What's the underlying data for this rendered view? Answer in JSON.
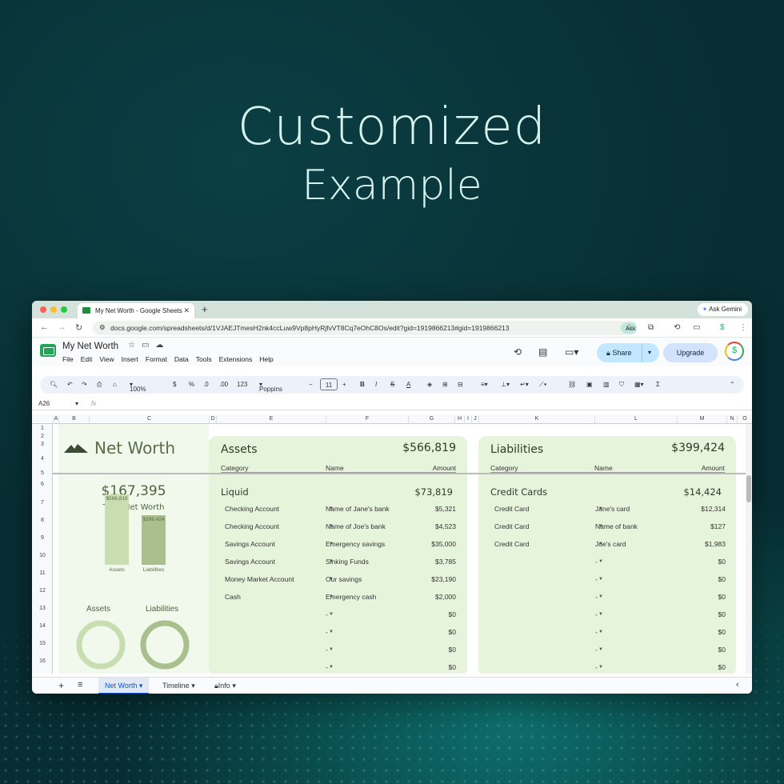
{
  "heading": {
    "line1": "Customized",
    "line2": "Example"
  },
  "browser": {
    "tab_title": "My Net Worth - Google Sheets",
    "new_tab": "+",
    "ask_gemini": "Ask Gemini",
    "url": "docs.google.com/spreadsheets/d/1VJAEJTmesH2nk4ccLuw9Vp8pHyRjfvVT8Cq7eOhC8Os/edit?gid=1919866213#gid=1919866213",
    "ask_google": "Ask Google"
  },
  "app": {
    "doc_title": "My Net Worth",
    "menu": [
      "File",
      "Edit",
      "View",
      "Insert",
      "Format",
      "Data",
      "Tools",
      "Extensions",
      "Help"
    ],
    "share": "Share",
    "upgrade": "Upgrade",
    "avatar": "$"
  },
  "toolbar": {
    "zoom": "100%",
    "currency": "$",
    "percent": "%",
    "dec_dec": ".0",
    "dec_inc": ".00",
    "num_format": "123",
    "font": "Poppins",
    "font_size": "11"
  },
  "formula_bar": {
    "name_box": "A26",
    "fx": "fx"
  },
  "columns": [
    "A",
    "B",
    "C",
    "D",
    "E",
    "F",
    "G",
    "H",
    "I",
    "J",
    "K",
    "L",
    "M",
    "N",
    "O"
  ],
  "rows": [
    "1",
    "2",
    "3",
    "4",
    "5",
    "6",
    "7",
    "8",
    "9",
    "10",
    "11",
    "12",
    "13",
    "14",
    "15",
    "16"
  ],
  "net_worth": {
    "title": "Net Worth",
    "total": "$167,395",
    "total_label": "Total Net Worth",
    "chart_data": {
      "type": "bar",
      "categories": [
        "Assets",
        "Liabilities"
      ],
      "values": [
        566819,
        399424
      ],
      "data_labels": [
        "$566,819",
        "$399,424"
      ]
    },
    "donut_labels": [
      "Assets",
      "Liabilities"
    ]
  },
  "assets": {
    "title": "Assets",
    "total": "$566,819",
    "headers": {
      "category": "Category",
      "name": "Name",
      "amount": "Amount"
    },
    "group": "Liquid",
    "group_total": "$73,819",
    "rows": [
      {
        "category": "Checking Account",
        "name": "Name of Jane's bank",
        "amount": "$5,321"
      },
      {
        "category": "Checking Account",
        "name": "Name of Joe's bank",
        "amount": "$4,523"
      },
      {
        "category": "Savings Account",
        "name": "Emergency savings",
        "amount": "$35,000"
      },
      {
        "category": "Savings Account",
        "name": "Sinking Funds",
        "amount": "$3,785"
      },
      {
        "category": "Money Market Account",
        "name": "Our savings",
        "amount": "$23,190"
      },
      {
        "category": "Cash",
        "name": "Emergency cash",
        "amount": "$2,000"
      },
      {
        "category": "",
        "name": "-",
        "amount": "$0"
      },
      {
        "category": "",
        "name": "-",
        "amount": "$0"
      },
      {
        "category": "",
        "name": "-",
        "amount": "$0"
      },
      {
        "category": "",
        "name": "-",
        "amount": "$0"
      }
    ]
  },
  "liabilities": {
    "title": "Liabilities",
    "total": "$399,424",
    "headers": {
      "category": "Category",
      "name": "Name",
      "amount": "Amount"
    },
    "group": "Credit Cards",
    "group_total": "$14,424",
    "rows": [
      {
        "category": "Credit Card",
        "name": "Jane's card",
        "amount": "$12,314"
      },
      {
        "category": "Credit Card",
        "name": "Name of bank",
        "amount": "$127"
      },
      {
        "category": "Credit Card",
        "name": "Joe's card",
        "amount": "$1,983"
      },
      {
        "category": "",
        "name": "-",
        "amount": "$0"
      },
      {
        "category": "",
        "name": "-",
        "amount": "$0"
      },
      {
        "category": "",
        "name": "-",
        "amount": "$0"
      },
      {
        "category": "",
        "name": "-",
        "amount": "$0"
      },
      {
        "category": "",
        "name": "-",
        "amount": "$0"
      },
      {
        "category": "",
        "name": "-",
        "amount": "$0"
      },
      {
        "category": "",
        "name": "-",
        "amount": "$0"
      }
    ]
  },
  "sheet_tabs": [
    {
      "label": "Net Worth",
      "active": true
    },
    {
      "label": "Timeline",
      "active": false
    },
    {
      "label": "Info",
      "active": false
    }
  ],
  "colors": {
    "panel": "#e7f4dc",
    "bar_assets": "#c8ddb0",
    "bar_liabilities": "#a9bf8e",
    "accent": "#5a6e4a"
  }
}
